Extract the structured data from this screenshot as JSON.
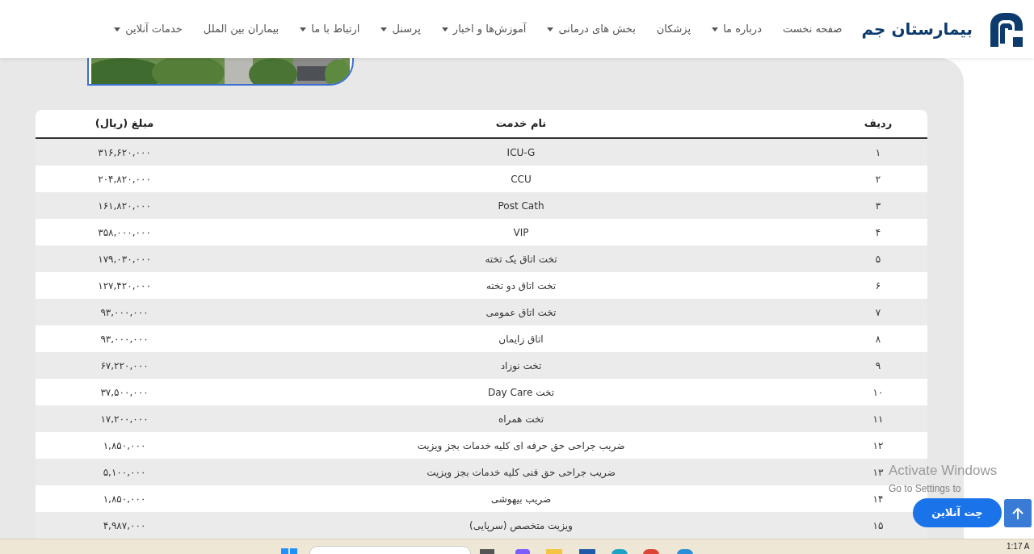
{
  "header": {
    "brand": "بیمارستان جم",
    "nav": [
      {
        "label": "صفحه نخست",
        "dropdown": false
      },
      {
        "label": "درباره ما",
        "dropdown": true
      },
      {
        "label": "پزشکان",
        "dropdown": false
      },
      {
        "label": "بخش های درمانی",
        "dropdown": true
      },
      {
        "label": "آموزش‌ها و اخبار",
        "dropdown": true
      },
      {
        "label": "پرسنل",
        "dropdown": true
      },
      {
        "label": "ارتباط با ما",
        "dropdown": true
      },
      {
        "label": "بیماران بین الملل",
        "dropdown": false
      },
      {
        "label": "خدمات آنلاین",
        "dropdown": true
      }
    ]
  },
  "table": {
    "columns": [
      "ردیف",
      "نام خدمت",
      "مبلغ (ریال)"
    ],
    "rows": [
      [
        "۱",
        "ICU-G",
        "۳۱۶,۶۲۰,۰۰۰"
      ],
      [
        "۲",
        "CCU",
        "۲۰۴,۸۲۰,۰۰۰"
      ],
      [
        "۳",
        "Post Cath",
        "۱۶۱,۸۲۰,۰۰۰"
      ],
      [
        "۴",
        "VIP",
        "۳۵۸,۰۰۰,۰۰۰"
      ],
      [
        "۵",
        "تخت اتاق یک تخته",
        "۱۷۹,۰۳۰,۰۰۰"
      ],
      [
        "۶",
        "تخت اتاق دو تخته",
        "۱۲۷,۴۲۰,۰۰۰"
      ],
      [
        "۷",
        "تخت اتاق عمومی",
        "۹۳,۰۰۰,۰۰۰"
      ],
      [
        "۸",
        "اتاق زایمان",
        "۹۳,۰۰۰,۰۰۰"
      ],
      [
        "۹",
        "تخت نوزاد",
        "۶۷,۲۲۰,۰۰۰"
      ],
      [
        "۱۰",
        "تخت Day Care",
        "۳۷,۵۰۰,۰۰۰"
      ],
      [
        "۱۱",
        "تخت همراه",
        "۱۷,۲۰۰,۰۰۰"
      ],
      [
        "۱۲",
        "ضریب جراحی حق حرفه ای کلیه خدمات بجز ویزیت",
        "۱,۸۵۰,۰۰۰"
      ],
      [
        "۱۳",
        "ضریب جراحی حق فنی کلیه خدمات بجز ویزیت",
        "۵,۱۰۰,۰۰۰"
      ],
      [
        "۱۴",
        "ضریب بیهوشی",
        "۱,۸۵۰,۰۰۰"
      ],
      [
        "۱۵",
        "ویزیت متخصص (سرپایی)",
        "۴,۹۸۷,۰۰۰"
      ]
    ]
  },
  "chat_button": "چت آنلاین",
  "os_notice": {
    "title": "Activate Windows",
    "subtitle": "Go to Settings to"
  },
  "taskbar": {
    "clock": "1:17 A"
  }
}
